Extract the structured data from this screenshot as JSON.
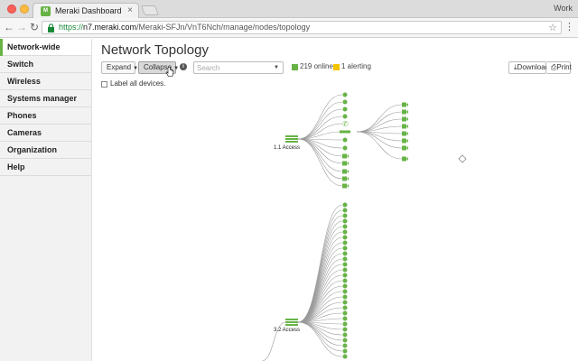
{
  "browser": {
    "tab_title": "Meraki Dashboard",
    "tab_favicon_text": "M",
    "profile": "Work",
    "url_scheme": "https://",
    "url_host": "n7.meraki.com",
    "url_path": "/Meraki-SFJn/VnT6Nch/manage/nodes/topology"
  },
  "sidebar": {
    "items": [
      {
        "label": "Network-wide",
        "active": true
      },
      {
        "label": "Switch"
      },
      {
        "label": "Wireless"
      },
      {
        "label": "Systems manager"
      },
      {
        "label": "Phones"
      },
      {
        "label": "Cameras"
      },
      {
        "label": "Organization"
      },
      {
        "label": "Help"
      }
    ]
  },
  "page": {
    "title": "Network Topology",
    "expand_label": "Expand",
    "collapse_label": "Collapse",
    "search_placeholder": "Search",
    "online_text": "219 online",
    "alerting_text": "1 alerting",
    "download_label": "Download",
    "print_label": "Print",
    "label_all_devices": "Label all devices."
  },
  "colors": {
    "accent": "#67b346",
    "online": "#67b346",
    "alerting": "#f5c400",
    "link": "#9a9a9a"
  },
  "topology": {
    "nodes": [
      {
        "label": "1.1 Access",
        "leaf_count": 15,
        "sub_children": 8
      },
      {
        "label": "3.2 Access",
        "leaf_count": 30
      }
    ]
  }
}
